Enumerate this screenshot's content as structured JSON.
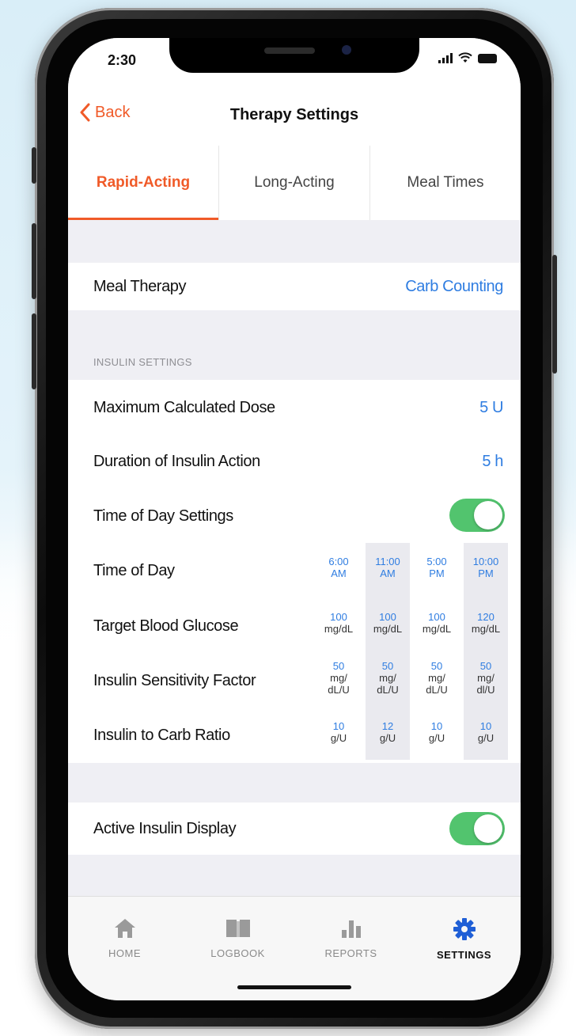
{
  "status": {
    "time": "2:30"
  },
  "nav": {
    "back_label": "Back",
    "title": "Therapy Settings"
  },
  "tabs": [
    {
      "label": "Rapid-Acting",
      "active": true
    },
    {
      "label": "Long-Acting",
      "active": false
    },
    {
      "label": "Meal Times",
      "active": false
    }
  ],
  "meal_therapy": {
    "label": "Meal Therapy",
    "value": "Carb Counting"
  },
  "insulin_settings": {
    "header": "INSULIN SETTINGS",
    "max_dose": {
      "label": "Maximum Calculated Dose",
      "value": "5 U"
    },
    "duration": {
      "label": "Duration of Insulin Action",
      "value": "5 h"
    },
    "time_of_day_settings": {
      "label": "Time of Day Settings",
      "enabled": true
    },
    "time_of_day": {
      "label": "Time of Day",
      "cols": [
        {
          "l1": "6:00",
          "l2": "AM"
        },
        {
          "l1": "11:00",
          "l2": "AM"
        },
        {
          "l1": "5:00",
          "l2": "PM"
        },
        {
          "l1": "10:00",
          "l2": "PM"
        }
      ]
    },
    "target_bg": {
      "label": "Target Blood Glucose",
      "cols": [
        {
          "v": "100",
          "u": "mg/dL"
        },
        {
          "v": "100",
          "u": "mg/dL"
        },
        {
          "v": "100",
          "u": "mg/dL"
        },
        {
          "v": "120",
          "u": "mg/dL"
        }
      ]
    },
    "isf": {
      "label": "Insulin Sensitivity Factor",
      "cols": [
        {
          "v": "50",
          "u1": "mg/",
          "u2": "dL/U"
        },
        {
          "v": "50",
          "u1": "mg/",
          "u2": "dL/U"
        },
        {
          "v": "50",
          "u1": "mg/",
          "u2": "dL/U"
        },
        {
          "v": "50",
          "u1": "mg/",
          "u2": "dl/U"
        }
      ]
    },
    "icr": {
      "label": "Insulin to Carb Ratio",
      "cols": [
        {
          "v": "10",
          "u": "g/U"
        },
        {
          "v": "12",
          "u": "g/U"
        },
        {
          "v": "10",
          "u": "g/U"
        },
        {
          "v": "10",
          "u": "g/U"
        }
      ]
    }
  },
  "active_insulin": {
    "label": "Active Insulin Display",
    "enabled": true
  },
  "tabbar": [
    {
      "label": "HOME",
      "icon": "home-icon",
      "active": false
    },
    {
      "label": "LOGBOOK",
      "icon": "book-icon",
      "active": false
    },
    {
      "label": "REPORTS",
      "icon": "bar-chart-icon",
      "active": false
    },
    {
      "label": "SETTINGS",
      "icon": "gear-icon",
      "active": true
    }
  ],
  "colors": {
    "accent": "#f05a28",
    "link": "#2f7de1",
    "toggle_on": "#52c46e"
  }
}
